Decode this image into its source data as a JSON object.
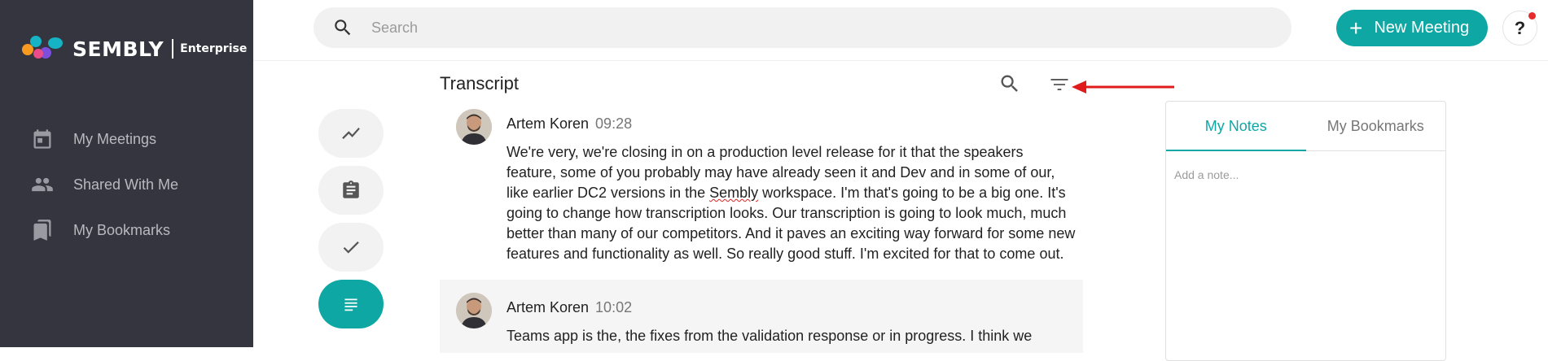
{
  "brand": {
    "name": "SEMBLY",
    "edition": "Enterprise",
    "colors": {
      "accent": "#0fa7a4",
      "sidebar": "#35353f",
      "dot_orange": "#f79a1f",
      "dot_teal": "#16b3c5",
      "dot_pink": "#ea4c89",
      "dot_purple": "#7b4fdc"
    }
  },
  "sidebar": {
    "items": [
      {
        "label": "My Meetings",
        "icon": "calendar-icon"
      },
      {
        "label": "Shared With Me",
        "icon": "people-icon"
      },
      {
        "label": "My Bookmarks",
        "icon": "bookmarks-icon"
      }
    ]
  },
  "header": {
    "search_placeholder": "Search",
    "new_meeting_label": "New Meeting",
    "help_label": "?"
  },
  "transcript": {
    "title": "Transcript",
    "entries": [
      {
        "speaker": "Artem Koren",
        "time": "09:28",
        "text_before": "We're very, we're closing in on a production level release for it that the speakers feature, some of you probably may have already seen it and Dev and in some of our, like earlier DC2 versions in the ",
        "text_spell": "Sembly",
        "text_after": " workspace. I'm that's going to be a big one. It's going to change how transcription looks. Our transcription is going to look much, much better than many of our competitors. And it paves an exciting way forward for some new features and functionality as well. So really good stuff. I'm excited for that to come out."
      },
      {
        "speaker": "Artem Koren",
        "time": "10:02",
        "text": "Teams app is the, the fixes from the validation response or in progress. I think we"
      }
    ]
  },
  "tools": [
    {
      "name": "analytics-icon"
    },
    {
      "name": "clipboard-icon"
    },
    {
      "name": "check-icon"
    },
    {
      "name": "transcript-icon",
      "active": true
    }
  ],
  "notes": {
    "tabs": [
      "My Notes",
      "My Bookmarks"
    ],
    "active_tab": "My Notes",
    "placeholder": "Add a note..."
  }
}
